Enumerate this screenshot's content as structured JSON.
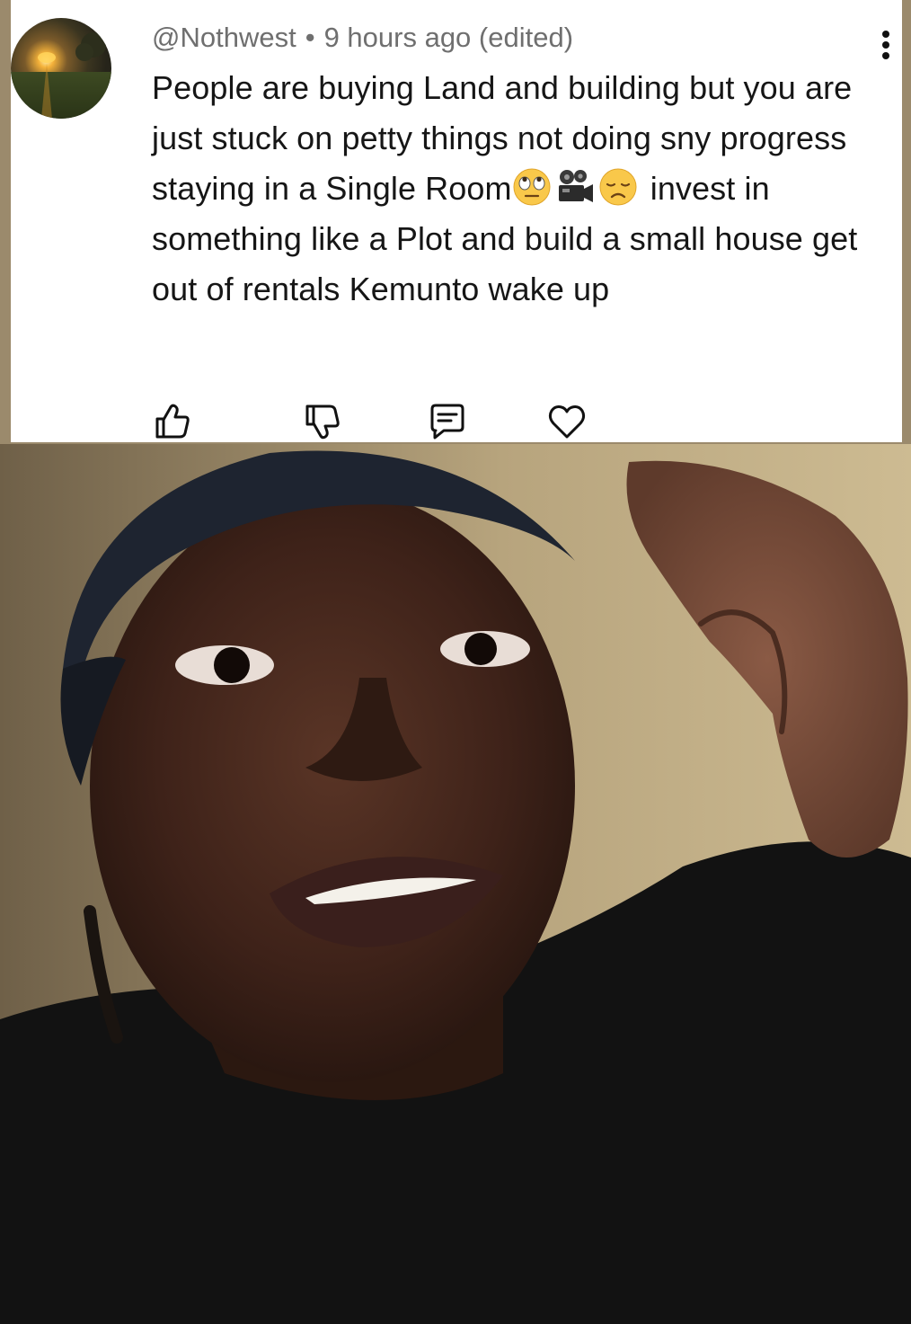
{
  "comment": {
    "username": "@Nothwest",
    "separator": "•",
    "timestamp": "9 hours ago (edited)",
    "text_part1": "People are buying Land and building but you are just stuck on petty things not doing sny progress staying in a  Single Room",
    "emojis": [
      "rolling-eyes-emoji",
      "video-camera-emoji",
      "disappointed-face-emoji"
    ],
    "text_part2": " invest in something like a Plot and build a small house get out of rentals Kemunto wake up"
  },
  "actions": {
    "like_icon": "thumbs-up-icon",
    "dislike_icon": "thumbs-down-icon",
    "reply_icon": "comment-icon",
    "heart_icon": "heart-icon"
  },
  "colors": {
    "meta": "#6f6f6f",
    "text": "#161616",
    "frame": "#9b8a6c"
  }
}
